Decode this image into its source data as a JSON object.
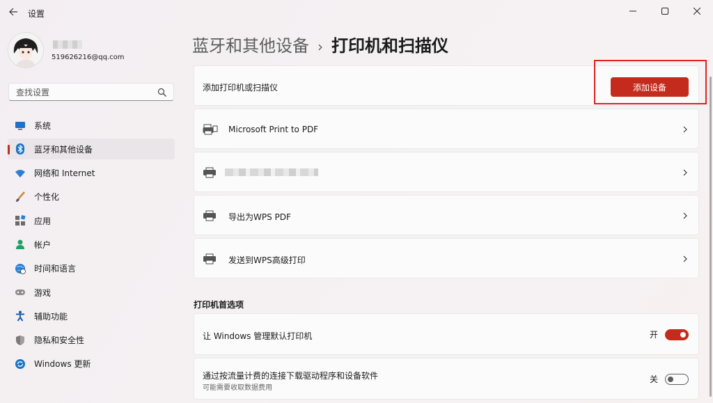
{
  "window": {
    "title": "设置"
  },
  "profile": {
    "email": "519626216@qq.com"
  },
  "search": {
    "placeholder": "查找设置"
  },
  "nav": {
    "items": [
      {
        "label": "系统"
      },
      {
        "label": "蓝牙和其他设备"
      },
      {
        "label": "网络和 Internet"
      },
      {
        "label": "个性化"
      },
      {
        "label": "应用"
      },
      {
        "label": "帐户"
      },
      {
        "label": "时间和语言"
      },
      {
        "label": "游戏"
      },
      {
        "label": "辅助功能"
      },
      {
        "label": "隐私和安全性"
      },
      {
        "label": "Windows 更新"
      }
    ]
  },
  "breadcrumb": {
    "parent": "蓝牙和其他设备",
    "separator": "›",
    "current": "打印机和扫描仪"
  },
  "add_device": {
    "label": "添加打印机或扫描仪",
    "button": "添加设备"
  },
  "printers": [
    {
      "name": "Microsoft Print to PDF"
    },
    {
      "name": ""
    },
    {
      "name": "导出为WPS PDF"
    },
    {
      "name": "发送到WPS高级打印"
    }
  ],
  "preferences": {
    "title": "打印机首选项",
    "default_printer": {
      "label": "让 Windows 管理默认打印机",
      "state_label": "开",
      "on": true
    },
    "metered": {
      "label": "通过按流量计费的连接下载驱动程序和设备软件",
      "sub": "可能需要收取数据费用",
      "state_label": "关",
      "on": false
    }
  },
  "colors": {
    "accent": "#c42b1c",
    "highlight_box": "#e02020"
  }
}
